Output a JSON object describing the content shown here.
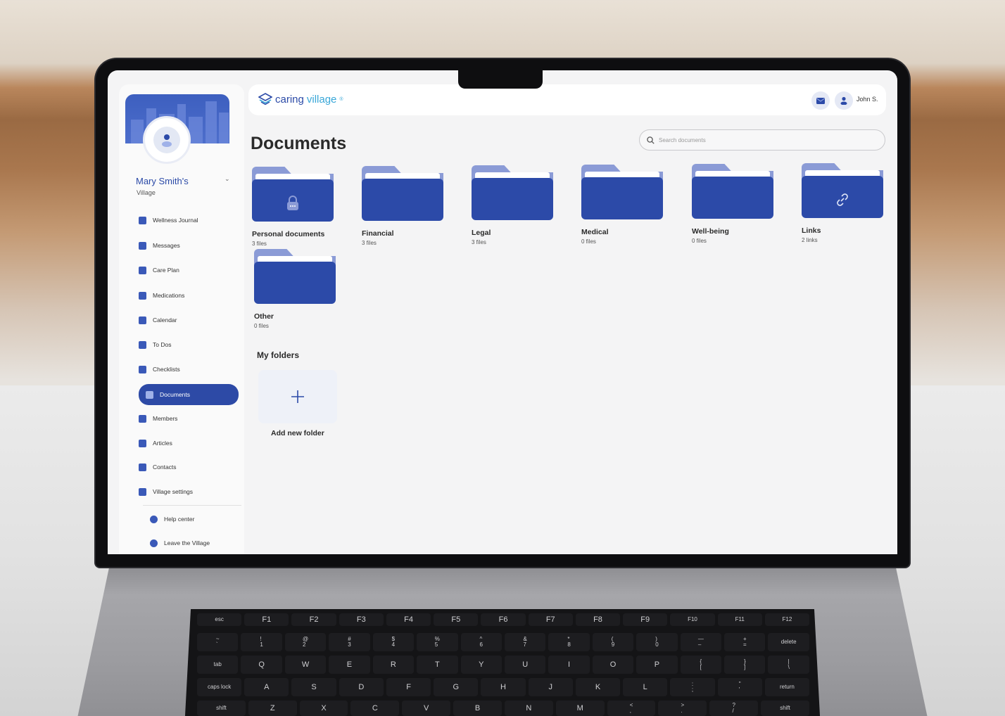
{
  "brand": {
    "logo_part1": "caring",
    "logo_part2": "village",
    "trademark": "®",
    "accent": "#2c4aa8",
    "accent_light": "#8b9bd6",
    "logo_secondary_color": "#39a7d8"
  },
  "header": {
    "user_name": "John S.",
    "mail_icon": "mail-icon",
    "user_icon": "user-icon"
  },
  "sidebar": {
    "village_name": "Mary Smith's",
    "village_sub": "Village",
    "items": [
      {
        "label": "Wellness Journal",
        "icon": "journal-icon"
      },
      {
        "label": "Messages",
        "icon": "mail-icon"
      },
      {
        "label": "Care Plan",
        "icon": "heart-icon"
      },
      {
        "label": "Medications",
        "icon": "pill-bottle-icon"
      },
      {
        "label": "Calendar",
        "icon": "calendar-icon"
      },
      {
        "label": "To Dos",
        "icon": "clipboard-icon"
      },
      {
        "label": "Checklists",
        "icon": "checklist-icon"
      },
      {
        "label": "Documents",
        "icon": "document-icon",
        "active": true
      },
      {
        "label": "Members",
        "icon": "members-icon"
      },
      {
        "label": "Articles",
        "icon": "article-icon"
      },
      {
        "label": "Contacts",
        "icon": "contact-card-icon"
      },
      {
        "label": "Village settings",
        "icon": "gear-icon"
      }
    ],
    "footer_items": [
      {
        "label": "Help center",
        "icon": "help-icon"
      },
      {
        "label": "Leave the Village",
        "icon": "exit-icon"
      }
    ]
  },
  "main": {
    "title": "Documents",
    "search_placeholder": "Search documents",
    "folders": [
      {
        "name": "Personal documents",
        "count": "3 files",
        "icon": "lock-icon"
      },
      {
        "name": "Financial",
        "count": "3 files"
      },
      {
        "name": "Legal",
        "count": "3 files"
      },
      {
        "name": "Medical",
        "count": "0 files"
      },
      {
        "name": "Well-being",
        "count": "0 files"
      },
      {
        "name": "Links",
        "count": "2 links",
        "icon": "link-icon"
      },
      {
        "name": "Other",
        "count": "0 files"
      }
    ],
    "my_folders_title": "My folders",
    "add_folder_label": "Add new folder"
  },
  "keyboard": {
    "row1": [
      "esc",
      "F1",
      "F2",
      "F3",
      "F4",
      "F5",
      "F6",
      "F7",
      "F8",
      "F9",
      "F10",
      "F11",
      "F12"
    ],
    "row2": [
      "~\n`",
      "!\n1",
      "@\n2",
      "#\n3",
      "$\n4",
      "%\n5",
      "^\n6",
      "&\n7",
      "*\n8",
      "(\n9",
      ")\n0",
      "—\n–",
      "+\n=",
      "delete"
    ],
    "row3": [
      "tab",
      "Q",
      "W",
      "E",
      "R",
      "T",
      "Y",
      "U",
      "I",
      "O",
      "P",
      "{\n[",
      "}\n]",
      "|\n\\"
    ],
    "row4": [
      "caps lock",
      "A",
      "S",
      "D",
      "F",
      "G",
      "H",
      "J",
      "K",
      "L",
      ":\n;",
      "\"\n'",
      "return"
    ],
    "row5": [
      "shift",
      "Z",
      "X",
      "C",
      "V",
      "B",
      "N",
      "M",
      "<\n,",
      ">\n.",
      "?\n/",
      "shift"
    ]
  }
}
